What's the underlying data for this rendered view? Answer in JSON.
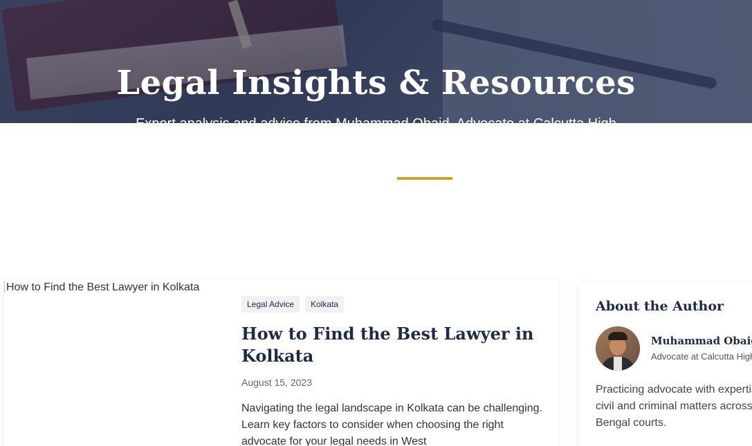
{
  "hero": {
    "title": "Legal Insights & Resources",
    "subtitle": "Expert analysis and advice from Muhammad Obaid, Advocate at Calcutta High"
  },
  "colors": {
    "accent_gold": "#c9a227",
    "navy": "#1e2a4a"
  },
  "post": {
    "image_alt": "How to Find the Best Lawyer in Kolkata",
    "tags": [
      "Legal Advice",
      "Kolkata"
    ],
    "title": "How to Find the Best Lawyer in Kolkata",
    "date": "August 15, 2023",
    "excerpt": "Navigating the legal landscape in Kolkata can be challenging. Learn key factors to consider when choosing the right advocate for your legal needs in West"
  },
  "sidebar": {
    "heading": "About the Author",
    "author_name": "Muhammad Obaid",
    "author_role": "Advocate at Calcutta High Court",
    "author_bio": "Practicing advocate with expertise in civil and criminal matters across West Bengal courts."
  }
}
